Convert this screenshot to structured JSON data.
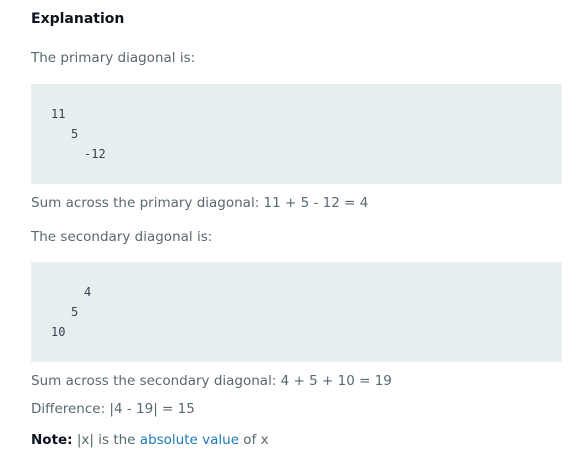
{
  "explanation": {
    "title": "Explanation",
    "primary_intro": "The primary diagonal is:",
    "primary_values": [
      "11",
      "5",
      "-12"
    ],
    "primary_sum": "Sum across the primary diagonal: 11 + 5 - 12 = 4",
    "secondary_intro": "The secondary diagonal is:",
    "secondary_values": [
      "4",
      "5",
      "10"
    ],
    "secondary_sum": "Sum across the secondary diagonal: 4 + 5 + 10 = 19",
    "difference": "Difference: |4 - 19| = 15",
    "note": {
      "label": "Note:",
      "before_link": " |x| is the ",
      "link_text": "absolute value",
      "after_link": " of x"
    }
  },
  "colors": {
    "heading": "#0e141e",
    "body_text": "#576871",
    "code_bg": "#e7eeef",
    "link": "#1f7ab8"
  }
}
